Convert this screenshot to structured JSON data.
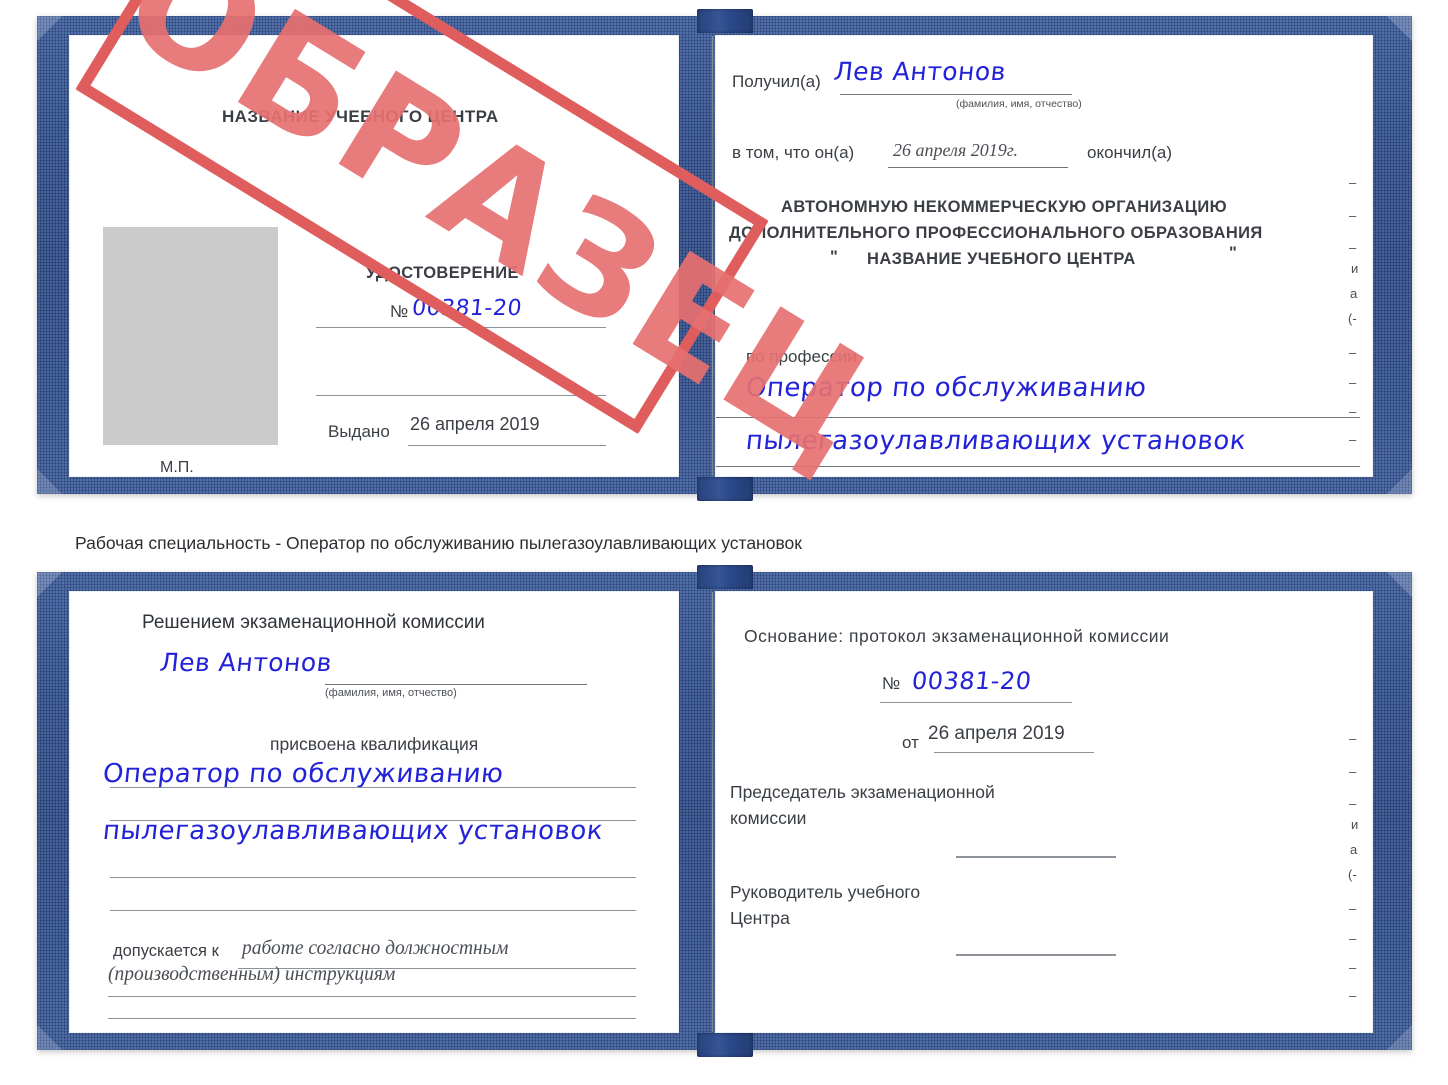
{
  "page": {
    "caption": "Рабочая специальность - Оператор по обслуживанию пылегазоулавливающих установок",
    "colors": {
      "cover_blue": "#2b4888",
      "stamp_red": "#e05d5d",
      "handwriting_blue": "#2222d8",
      "photo_placeholder_gray": "#cbcbcb",
      "rule_gray": "#8d9298"
    }
  },
  "watermark": {
    "label": "ОБРАЗЕЦ"
  },
  "certificate_top": {
    "left_page": {
      "org_title": "НАЗВАНИЕ УЧЕБНОГО ЦЕНТРА",
      "doc_title": "УДОСТОВЕРЕНИЕ",
      "number_label": "№",
      "number_value": "00381-20",
      "issued_label": "Выдано",
      "issued_date": "26 апреля 2019",
      "seal_label": "М.П.",
      "photo_placeholder": ""
    },
    "right_page": {
      "received_label": "Получил(а)",
      "received_name": "Лев Антонов",
      "name_hint": "(фамилия, имя, отчество)",
      "in_that_label": "в том, что он(а)",
      "completion_date": "26 апреля 2019г.",
      "finished_label": "окончил(а)",
      "org_line1": "АВТОНОМНУЮ НЕКОММЕРЧЕСКУЮ ОРГАНИЗАЦИЮ",
      "org_line2": "ДОПОЛНИТЕЛЬНОГО ПРОФЕССИОНАЛЬНОГО ОБРАЗОВАНИЯ",
      "org_quote_open": "\"",
      "org_line3": "НАЗВАНИЕ УЧЕБНОГО ЦЕНТРА",
      "org_quote_close": "\"",
      "profession_label": "по профессии",
      "profession_line1": "Оператор по обслуживанию",
      "profession_line2": "пылегазоулавливающих установок",
      "margin_fragments": [
        "–",
        "–",
        "–",
        "и",
        "а",
        "(-",
        "–",
        "–",
        "–",
        "–"
      ]
    }
  },
  "certificate_bottom": {
    "left_page": {
      "decision_title": "Решением экзаменационной комиссии",
      "name": "Лев Антонов",
      "name_hint": "(фамилия, имя, отчество)",
      "qualification_label": "присвоена квалификация",
      "qualification_line1": "Оператор по обслуживанию",
      "qualification_line2": "пылегазоулавливающих установок",
      "admitted_label": "допускается к",
      "admitted_line1": "работе согласно должностным",
      "admitted_line2": "(производственным) инструкциям"
    },
    "right_page": {
      "basis_label": "Основание: протокол экзаменационной комиссии",
      "number_label": "№",
      "number_value": "00381-20",
      "date_label": "от",
      "date_value": "26 апреля 2019",
      "chairman_line1": "Председатель экзаменационной",
      "chairman_line2": "комиссии",
      "head_line1": "Руководитель учебного",
      "head_line2": "Центра",
      "margin_fragments": [
        "–",
        "–",
        "–",
        "и",
        "а",
        "(-",
        "–",
        "–",
        "–",
        "–"
      ]
    }
  }
}
